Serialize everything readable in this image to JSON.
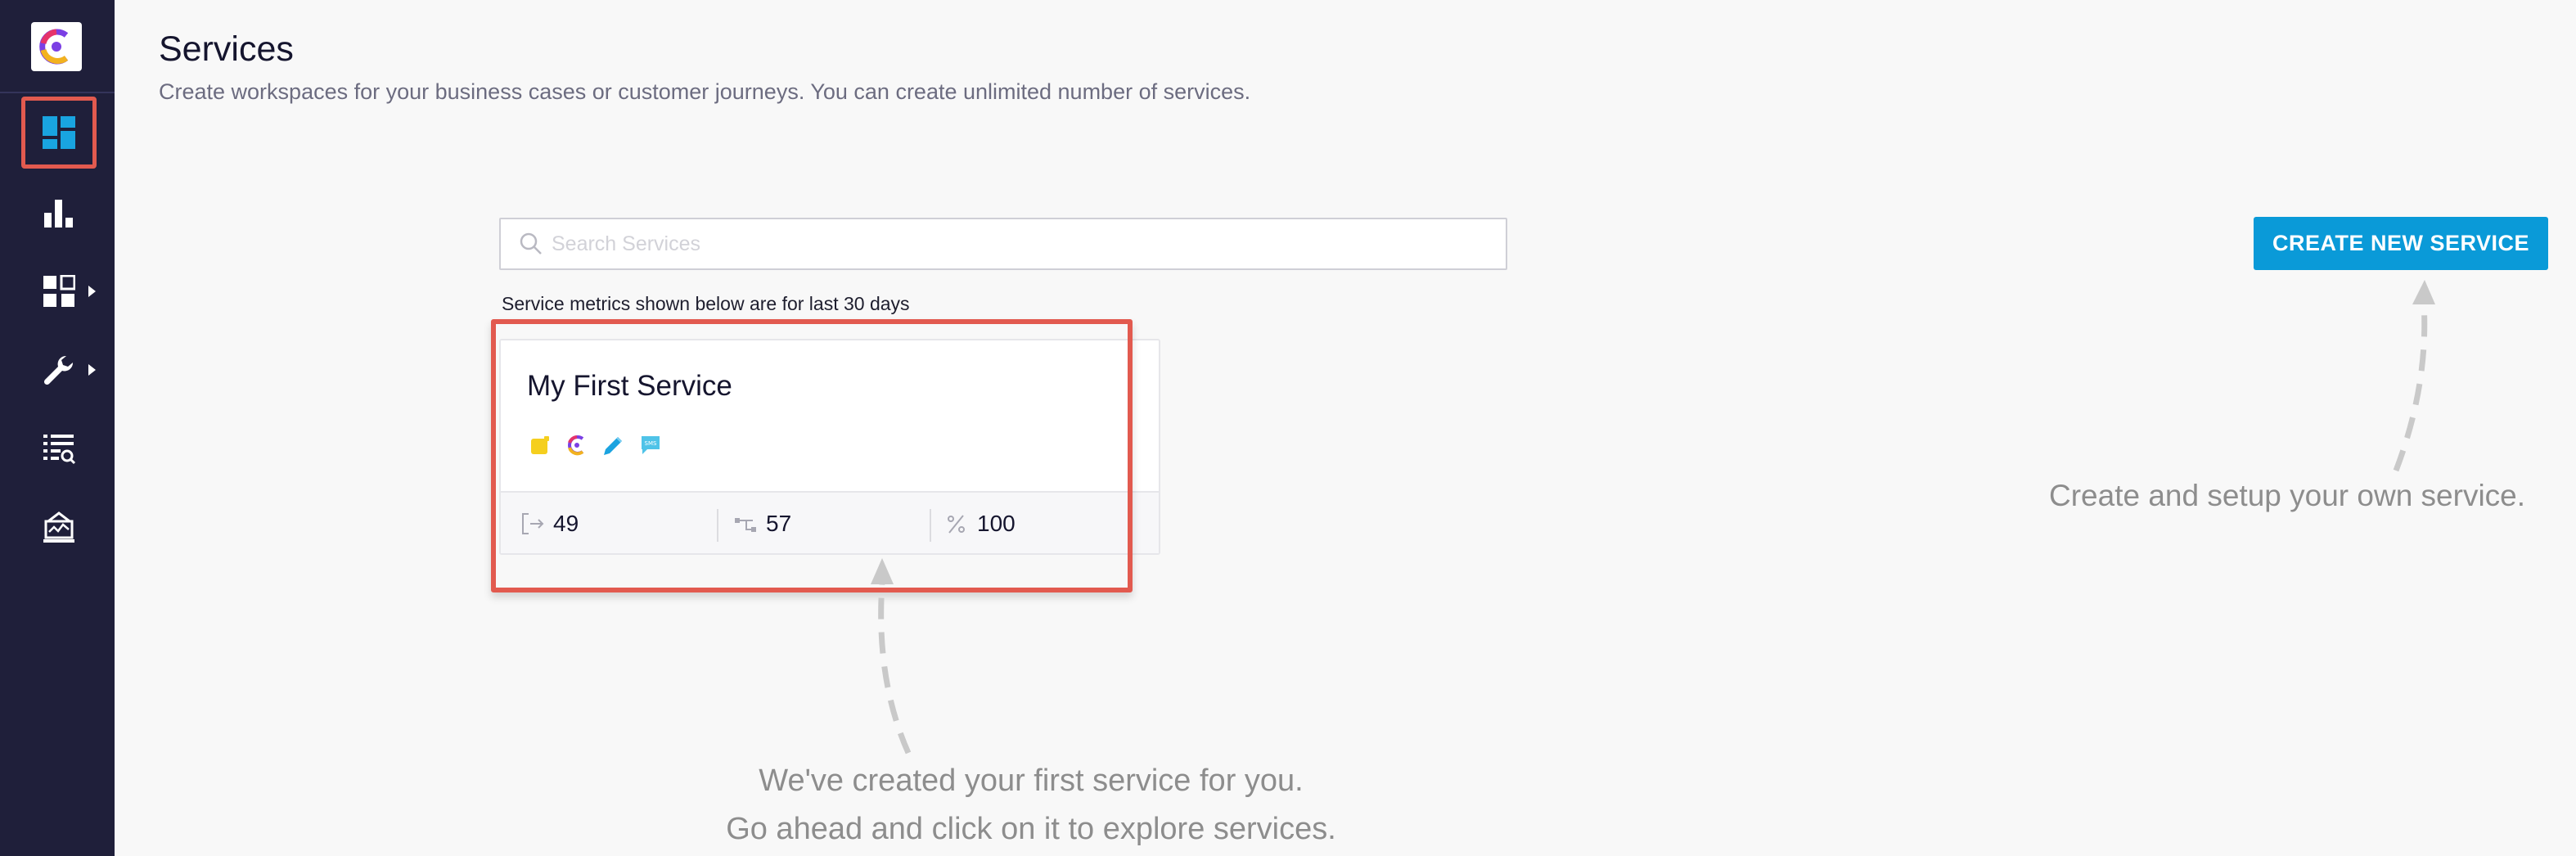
{
  "sidebar": {
    "logo": "c-logo",
    "items": [
      {
        "icon": "dashboard-icon",
        "active": true
      },
      {
        "icon": "bar-chart-icon"
      },
      {
        "icon": "apps-grid-icon",
        "has_submenu": true
      },
      {
        "icon": "wrench-icon",
        "has_submenu": true
      },
      {
        "icon": "log-search-icon"
      },
      {
        "icon": "monitor-icon"
      }
    ]
  },
  "header": {
    "title": "Services",
    "subtitle": "Create workspaces for your business cases or customer journeys. You can create unlimited number of services."
  },
  "search": {
    "placeholder": "Search Services",
    "value": ""
  },
  "create_button": {
    "label": "CREATE NEW SERVICE"
  },
  "metrics_note": "Service metrics shown below are for last 30 days",
  "service_card": {
    "title": "My First Service",
    "channels": [
      "notes-icon",
      "c-logo-icon",
      "pen-icon",
      "sms-icon"
    ],
    "metrics": [
      {
        "icon": "entry-icon",
        "value": "49"
      },
      {
        "icon": "flow-icon",
        "value": "57"
      },
      {
        "icon": "percent-icon",
        "value": "100"
      }
    ]
  },
  "annotations": {
    "right": "Create and setup your own service.",
    "bottom_line1": "We've created your first service for you.",
    "bottom_line2": "Go ahead and click on it to explore services."
  },
  "colors": {
    "sidebar": "#1f1f3a",
    "accent": "#0a9ad8",
    "highlight": "#e25a4f",
    "background": "#f8f8f8"
  }
}
